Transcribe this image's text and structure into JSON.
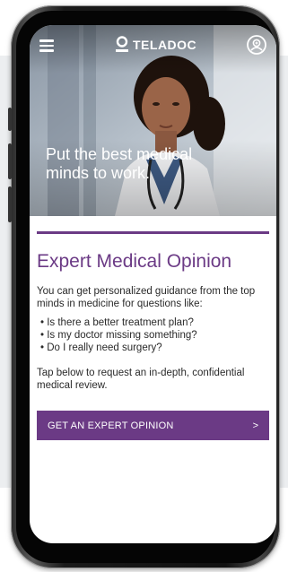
{
  "app": {
    "brand": "TELADOC"
  },
  "hero": {
    "headline": "Put the best medical minds to work."
  },
  "header": {
    "menu_icon": "hamburger-menu-icon",
    "profile_icon": "doctor-avatar-icon"
  },
  "content": {
    "title": "Expert Medical Opinion",
    "intro": "You can get personalized guidance from the top minds in medicine for questions like:",
    "bullets": [
      "• Is there a better treatment plan?",
      "• Is my doctor missing something?",
      "• Do I really need surgery?"
    ],
    "tap_text": "Tap below to request an in-depth, confidential medical review."
  },
  "cta": {
    "label": "GET AN EXPERT OPINION",
    "arrow": ">"
  },
  "colors": {
    "accent": "#6b3a85",
    "text": "#2a2a2a",
    "background_panel": "#eceef0"
  }
}
